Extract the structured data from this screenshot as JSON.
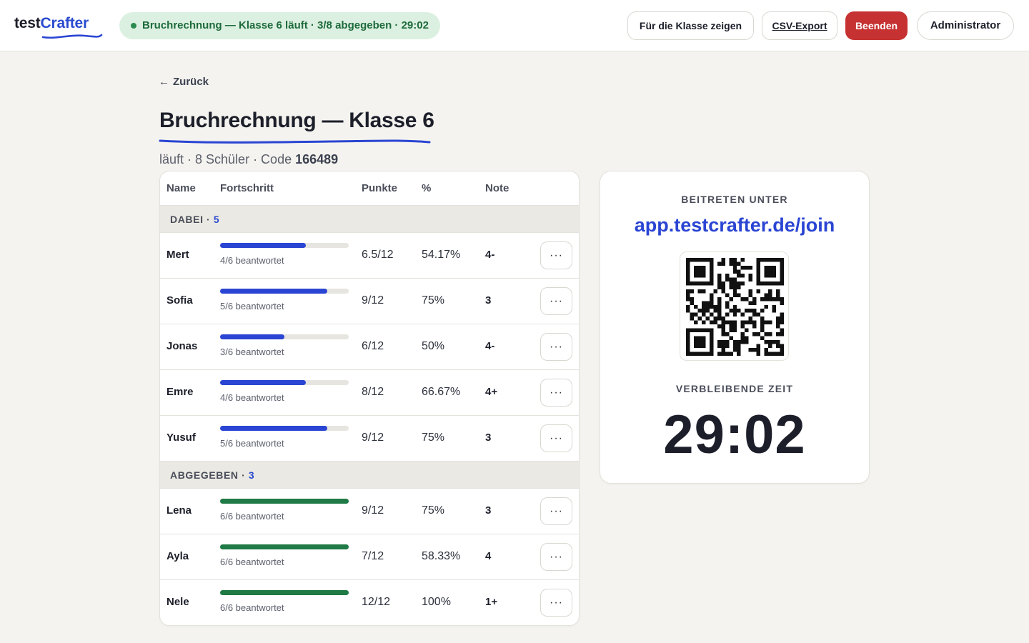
{
  "header": {
    "logo_part1": "test",
    "logo_part2": "Crafter",
    "status": "Bruchrechnung — Klasse 6 läuft · 3/8 abgegeben · 29:02",
    "show_class_label": "Für die Klasse zeigen",
    "csv_export_label": "CSV-Export",
    "end_label": "Beenden",
    "user_label": "Administrator"
  },
  "page": {
    "back_label": "Zurück",
    "title": "Bruchrechnung — Klasse 6",
    "meta_prefix": "läuft · 8 Schüler · Code ",
    "code": "166489"
  },
  "table": {
    "columns": [
      "Name",
      "Fortschritt",
      "Punkte",
      "%",
      "Note"
    ],
    "sections": [
      {
        "label": "DABEI",
        "count": "5",
        "status": "active",
        "rows": [
          {
            "name": "Mert",
            "progress": 0.667,
            "answered": "4/6 beantwortet",
            "points": "6.5/12",
            "percent": "54.17%",
            "grade": "4-"
          },
          {
            "name": "Sofia",
            "progress": 0.833,
            "answered": "5/6 beantwortet",
            "points": "9/12",
            "percent": "75%",
            "grade": "3"
          },
          {
            "name": "Jonas",
            "progress": 0.5,
            "answered": "3/6 beantwortet",
            "points": "6/12",
            "percent": "50%",
            "grade": "4-"
          },
          {
            "name": "Emre",
            "progress": 0.667,
            "answered": "4/6 beantwortet",
            "points": "8/12",
            "percent": "66.67%",
            "grade": "4+"
          },
          {
            "name": "Yusuf",
            "progress": 0.833,
            "answered": "5/6 beantwortet",
            "points": "9/12",
            "percent": "75%",
            "grade": "3"
          }
        ]
      },
      {
        "label": "ABGEGEBEN",
        "count": "3",
        "status": "done",
        "rows": [
          {
            "name": "Lena",
            "progress": 1,
            "answered": "6/6 beantwortet",
            "points": "9/12",
            "percent": "75%",
            "grade": "3"
          },
          {
            "name": "Ayla",
            "progress": 1,
            "answered": "6/6 beantwortet",
            "points": "7/12",
            "percent": "58.33%",
            "grade": "4"
          },
          {
            "name": "Nele",
            "progress": 1,
            "answered": "6/6 beantwortet",
            "points": "12/12",
            "percent": "100%",
            "grade": "1+"
          }
        ]
      }
    ],
    "row_action_label": "···"
  },
  "join": {
    "caption": "BEITRETEN UNTER",
    "url": "app.testcrafter.de/join",
    "timer_caption": "VERBLEIBENDE ZEIT",
    "timer": "29:02"
  },
  "colors": {
    "brand_blue": "#2a45d3",
    "danger_red": "#c63232",
    "success_green": "#1f7a45",
    "status_pill_bg": "#dcf0e1",
    "page_bg": "#f4f3ef"
  },
  "icons": {
    "back": "arrow-left-icon",
    "more": "more-horizontal-icon",
    "status": "status-dot-icon",
    "qr": "qr-code-icon"
  }
}
